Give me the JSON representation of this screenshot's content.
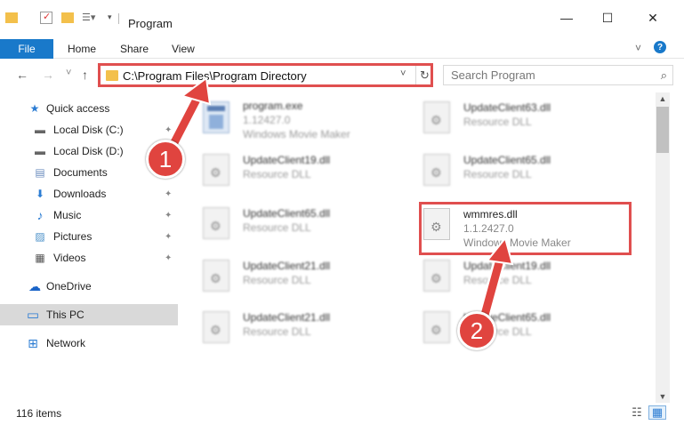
{
  "window": {
    "title": "Program",
    "controls": {
      "minimize": "—",
      "maximize": "☐",
      "close": "✕"
    }
  },
  "ribbon": {
    "tabs": [
      {
        "label": "File"
      },
      {
        "label": "Home"
      },
      {
        "label": "Share"
      },
      {
        "label": "View"
      }
    ],
    "expand_icon": "˅",
    "help_icon": "?"
  },
  "address": {
    "path": "C:\\Program Files\\Program Directory",
    "back": "←",
    "forward": "→",
    "recent": "˅",
    "up": "↑",
    "dropdown": "˅",
    "refresh": "↻"
  },
  "search": {
    "placeholder": "Search Program",
    "icon": "⌕"
  },
  "nav": {
    "items": [
      {
        "label": "Quick access",
        "icon": "star-icon",
        "glyph": "★",
        "color": "#2b7cd3",
        "pinned": false
      },
      {
        "label": "Local Disk (C:)",
        "icon": "drive-icon",
        "glyph": "▬",
        "color": "#666666",
        "pinned": true
      },
      {
        "label": "Local Disk (D:)",
        "icon": "drive-icon",
        "glyph": "▬",
        "color": "#666666",
        "pinned": true
      },
      {
        "label": "Documents",
        "icon": "documents-icon",
        "glyph": "▤",
        "color": "#6c8ebf",
        "pinned": true
      },
      {
        "label": "Downloads",
        "icon": "downloads-icon",
        "glyph": "⬇",
        "color": "#2b7cd3",
        "pinned": true
      },
      {
        "label": "Music",
        "icon": "music-icon",
        "glyph": "♪",
        "color": "#2b7cd3",
        "pinned": true
      },
      {
        "label": "Pictures",
        "icon": "pictures-icon",
        "glyph": "▨",
        "color": "#4a90c8",
        "pinned": true
      },
      {
        "label": "Videos",
        "icon": "videos-icon",
        "glyph": "▦",
        "color": "#555555",
        "pinned": true
      },
      {
        "label": "OneDrive",
        "icon": "cloud-icon",
        "glyph": "☁",
        "color": "#1a64c8",
        "pinned": false
      },
      {
        "label": "This PC",
        "icon": "pc-icon",
        "glyph": "▭",
        "color": "#2b7cd3",
        "pinned": false,
        "selected": true
      },
      {
        "label": "Network",
        "icon": "network-icon",
        "glyph": "⊞",
        "color": "#2b7cd3",
        "pinned": false
      }
    ],
    "pin_glyph": "📌"
  },
  "files": [
    {
      "name": "program.exe",
      "line2": "1.12427.0",
      "line3": "Windows Movie Maker"
    },
    {
      "name": "UpdateClient63.dll",
      "line2": "Resource DLL"
    },
    {
      "name": "UpdateClient19.dll",
      "line2": "Resource DLL"
    },
    {
      "name": "UpdateClient65.dll",
      "line2": "Resource DLL"
    },
    {
      "name": "UpdateClient65.dll",
      "line2": "Resource DLL"
    },
    {
      "name": "wmmres.dll",
      "line2": "1.1.2427.0",
      "line3": "Windows Movie Maker"
    },
    {
      "name": "UpdateClient21.dll",
      "line2": "Resource DLL"
    },
    {
      "name": "UpdateClient19.dll",
      "line2": "Resource DLL"
    },
    {
      "name": "UpdateClient21.dll",
      "line2": "Resource DLL"
    },
    {
      "name": "UpdateClient65.dll",
      "line2": "Resource DLL"
    }
  ],
  "callouts": {
    "one": "1",
    "two": "2"
  },
  "status": {
    "count": "116 items"
  },
  "view_buttons": {
    "details": "☷",
    "tiles": "▦"
  },
  "scrollbar": {
    "up": "▲",
    "down": "▼"
  },
  "colors": {
    "accent": "#1979ca",
    "highlight": "#e04f4f"
  }
}
